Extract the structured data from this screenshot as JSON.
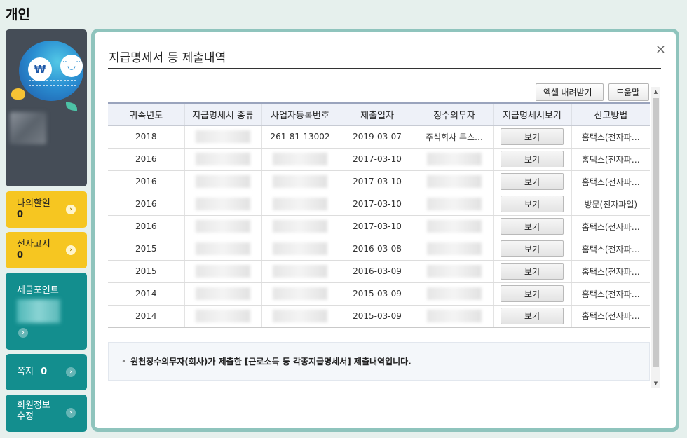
{
  "page_title": "개인",
  "sidebar": {
    "profile": {
      "won_symbol": "₩",
      "smile": "˘◡˘"
    },
    "cards": [
      {
        "label": "나의할일",
        "count": "0",
        "icon": "chevron-right-icon"
      },
      {
        "label": "전자고지",
        "count": "0",
        "icon": "chevron-right-icon"
      },
      {
        "label": "세금포인트",
        "icon": "chevron-right-icon"
      },
      {
        "label": "쪽지",
        "count": "0",
        "icon": "chevron-right-icon"
      },
      {
        "label": "회원정보 수정",
        "icon": "chevron-right-icon"
      }
    ]
  },
  "panel": {
    "title": "지급명세서 등 제출내역",
    "close_icon": "×",
    "excel_button": "엑셀 내려받기",
    "help_button": "도움말",
    "columns": [
      "귀속년도",
      "지급명세서 종류",
      "사업자등록번호",
      "제출일자",
      "징수의무자",
      "지급명세서보기",
      "신고방법"
    ],
    "rows": [
      {
        "year": "2018",
        "biz_no": "261-81-13002",
        "date": "2019-03-07",
        "payer": "주식회사 투스…",
        "view": "보기",
        "method": "홈택스(전자파…"
      },
      {
        "year": "2016",
        "biz_no": "",
        "date": "2017-03-10",
        "payer": "",
        "view": "보기",
        "method": "홈택스(전자파…"
      },
      {
        "year": "2016",
        "biz_no": "",
        "date": "2017-03-10",
        "payer": "",
        "view": "보기",
        "method": "홈택스(전자파…"
      },
      {
        "year": "2016",
        "biz_no": "",
        "date": "2017-03-10",
        "payer": "",
        "view": "보기",
        "method": "방문(전자파일)"
      },
      {
        "year": "2016",
        "biz_no": "",
        "date": "2017-03-10",
        "payer": "",
        "view": "보기",
        "method": "홈택스(전자파…"
      },
      {
        "year": "2015",
        "biz_no": "",
        "date": "2016-03-08",
        "payer": "",
        "view": "보기",
        "method": "홈택스(전자파…"
      },
      {
        "year": "2015",
        "biz_no": "",
        "date": "2016-03-09",
        "payer": "",
        "view": "보기",
        "method": "홈택스(전자파…"
      },
      {
        "year": "2014",
        "biz_no": "",
        "date": "2015-03-09",
        "payer": "",
        "view": "보기",
        "method": "홈택스(전자파…"
      },
      {
        "year": "2014",
        "biz_no": "",
        "date": "2015-03-09",
        "payer": "",
        "view": "보기",
        "method": "홈택스(전자파…"
      }
    ],
    "notice": "원천징수의무자(회사)가 제출한 [근로소득 등 각종지급명세서] 제출내역입니다."
  },
  "colors": {
    "accent_teal": "#138e8e",
    "accent_yellow": "#f6c621",
    "frame": "#8fc4bd"
  }
}
